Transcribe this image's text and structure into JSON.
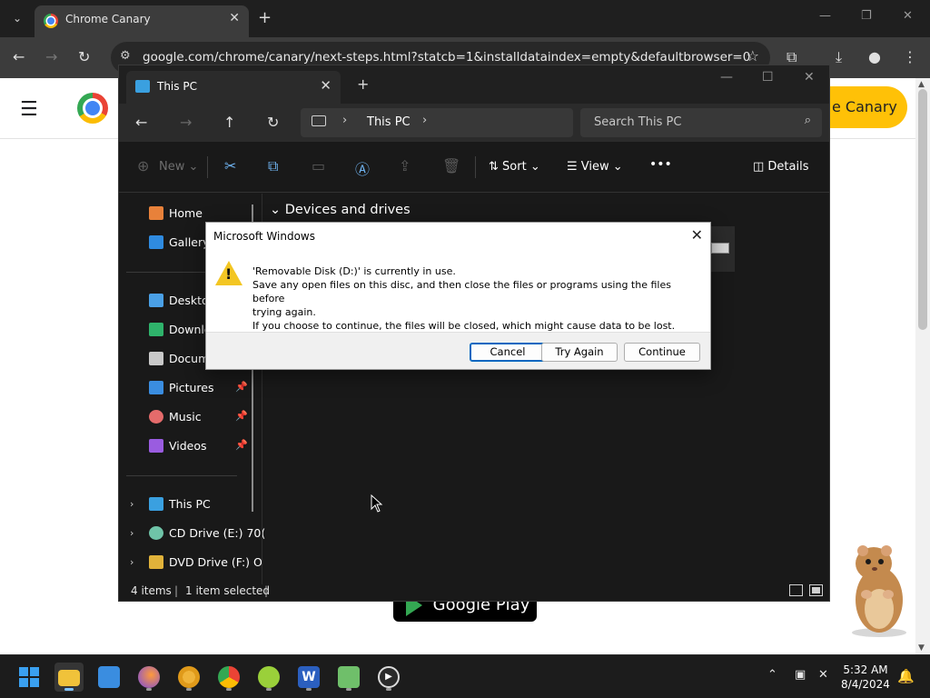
{
  "browser": {
    "tab_title": "Chrome Canary",
    "url": "google.com/chrome/canary/next-steps.html?statcb=1&installdataindex=empty&defaultbrowser=0"
  },
  "page": {
    "cta_label": "e Canary",
    "store_badge_label": "Google Play"
  },
  "explorer": {
    "tab_title": "This PC",
    "breadcrumb": [
      "This PC"
    ],
    "search_placeholder": "Search This PC",
    "commands": {
      "new": "New",
      "sort": "Sort",
      "view": "View",
      "more": "•••",
      "details": "Details"
    },
    "sidebar": {
      "quick_access": [
        {
          "label": "Home",
          "icon": "home-icon",
          "color": "#e8813a"
        },
        {
          "label": "Gallery",
          "icon": "gallery-icon",
          "color": "#2f8be0"
        }
      ],
      "pinned": [
        {
          "label": "Desktop",
          "icon": "desktop-icon",
          "color": "#4aa0e6"
        },
        {
          "label": "Downlo",
          "icon": "download-icon",
          "color": "#2fb36b"
        },
        {
          "label": "Docum",
          "icon": "document-icon",
          "color": "#c9c9c9"
        },
        {
          "label": "Pictures",
          "icon": "pictures-icon",
          "color": "#3a8de0"
        },
        {
          "label": "Music",
          "icon": "music-icon",
          "color": "#e56b6b"
        },
        {
          "label": "Videos",
          "icon": "videos-icon",
          "color": "#9a5ce0"
        }
      ],
      "drives": [
        {
          "label": "This PC",
          "icon": "computer-icon",
          "color": "#3aa0e0"
        },
        {
          "label": "CD Drive (E:) 70(",
          "icon": "cd-drive-icon",
          "color": "#6fc4a8"
        },
        {
          "label": "DVD Drive (F:) O",
          "icon": "dvd-drive-icon",
          "color": "#e0b23a"
        }
      ]
    },
    "group_header": "Devices and drives",
    "status": {
      "count": "4 items",
      "selected": "1 item selected"
    }
  },
  "dialog": {
    "title": "Microsoft Windows",
    "message_lines": [
      "'Removable Disk (D:)' is currently in use.",
      "Save any open files on this disc, and then close the files or programs using the files before",
      "trying again.",
      "If you choose to continue, the files will be closed, which might cause data to be lost."
    ],
    "buttons": {
      "cancel": "Cancel",
      "try_again": "Try Again",
      "continue": "Continue"
    }
  },
  "taskbar": {
    "apps": [
      {
        "name": "start-button",
        "color": "#3aa0f0"
      },
      {
        "name": "file-explorer-app",
        "color": "#f0c23a"
      },
      {
        "name": "store-app",
        "color": "#3a8de0"
      },
      {
        "name": "firefox-app",
        "color": "#7a4ae0"
      },
      {
        "name": "chrome-canary-app",
        "color": "#f0b43a"
      },
      {
        "name": "chrome-app",
        "color": "#ea4335"
      },
      {
        "name": "snagit-app",
        "color": "#9ad03a"
      },
      {
        "name": "word-app",
        "color": "#2b5fbf"
      },
      {
        "name": "notepad-app",
        "color": "#6fbf6a"
      },
      {
        "name": "media-player-app",
        "color": "#dcdcdc"
      }
    ],
    "time": "5:32 AM",
    "date": "8/4/2024"
  }
}
